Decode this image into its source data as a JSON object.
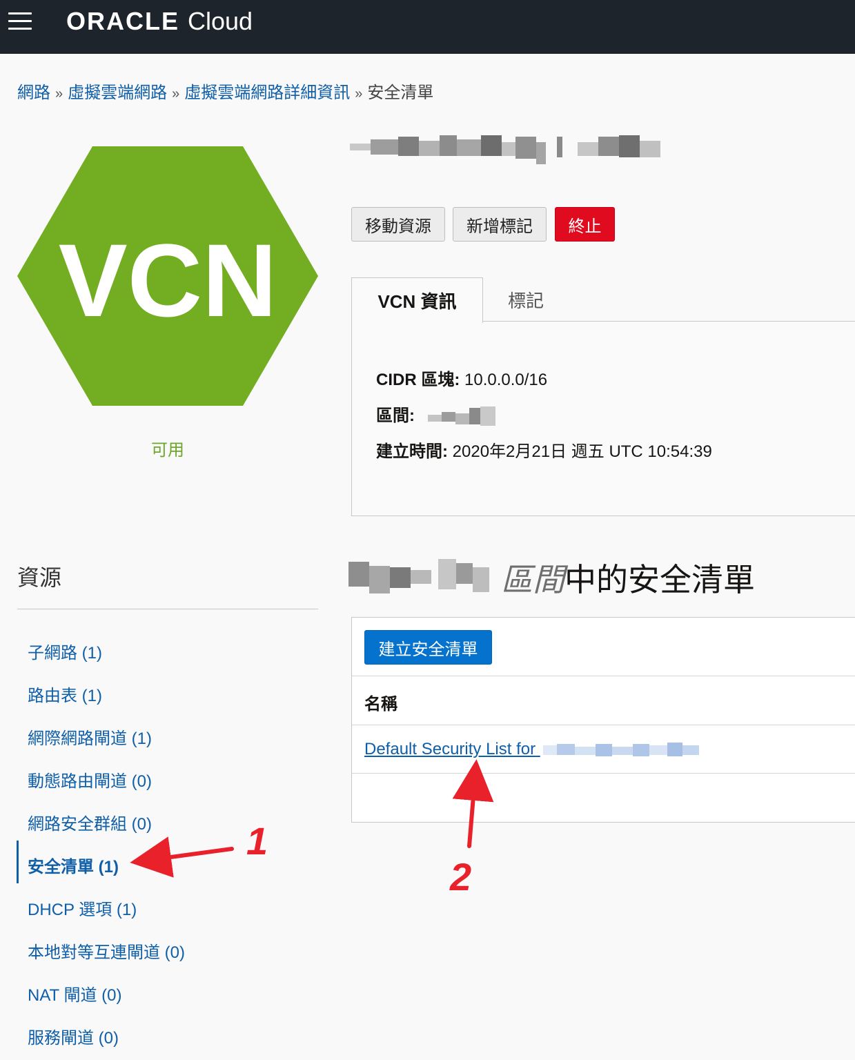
{
  "header": {
    "brand": "ORACLE",
    "product": "Cloud"
  },
  "breadcrumb": {
    "items": [
      "網路",
      "虛擬雲端網路",
      "虛擬雲端網路詳細資訊"
    ],
    "separator": "»",
    "current": "安全清單"
  },
  "vcn": {
    "icon_label": "VCN",
    "icon_color": "#73ad21",
    "status": "可用",
    "status_color": "#6ea52a"
  },
  "actions": {
    "move": "移動資源",
    "add_tag": "新增標記",
    "terminate": "終止"
  },
  "tabs": {
    "info": "VCN 資訊",
    "tags": "標記"
  },
  "info": {
    "cidr_label": "CIDR 區塊:",
    "cidr_value": "10.0.0.0/16",
    "compartment_label": "區間:",
    "created_label": "建立時間:",
    "created_value": "2020年2月21日 週五 UTC 10:54:39"
  },
  "resources": {
    "title": "資源",
    "items": [
      "子網路 (1)",
      "路由表 (1)",
      "網際網路閘道 (1)",
      "動態路由閘道 (0)",
      "網路安全群組 (0)",
      "安全清單 (1)",
      "DHCP 選項 (1)",
      "本地對等互連閘道 (0)",
      "NAT 閘道 (0)",
      "服務閘道 (0)"
    ]
  },
  "security_lists": {
    "heading_italic": "區間",
    "heading_rest": "中的安全清單",
    "create_button": "建立安全清單",
    "column_name": "名稱",
    "rows": [
      "Default Security List for"
    ]
  },
  "annotations": {
    "one": "1",
    "two": "2",
    "color": "#e8212a"
  }
}
